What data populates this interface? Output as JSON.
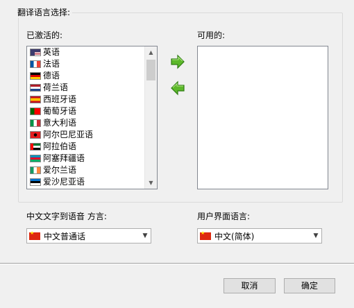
{
  "group_title": "翻译语言选择:",
  "active_label": "已激活的:",
  "available_label": "可用的:",
  "active_languages": [
    {
      "name": "英语",
      "flag": "us-flag-icon"
    },
    {
      "name": "法语",
      "flag": "france-flag-icon"
    },
    {
      "name": "德语",
      "flag": "germany-flag-icon"
    },
    {
      "name": "荷兰语",
      "flag": "netherlands-flag-icon"
    },
    {
      "name": "西班牙语",
      "flag": "spain-flag-icon"
    },
    {
      "name": "葡萄牙语",
      "flag": "portugal-flag-icon"
    },
    {
      "name": "意大利语",
      "flag": "italy-flag-icon"
    },
    {
      "name": "阿尔巴尼亚语",
      "flag": "albania-flag-icon"
    },
    {
      "name": "阿拉伯语",
      "flag": "uae-flag-icon"
    },
    {
      "name": "阿塞拜疆语",
      "flag": "azerbaijan-flag-icon"
    },
    {
      "name": "爱尔兰语",
      "flag": "ireland-flag-icon"
    },
    {
      "name": "爱沙尼亚语",
      "flag": "estonia-flag-icon"
    }
  ],
  "available_languages": [],
  "tts_label": "中文文字到语音 方言:",
  "tts_value": "中文普通话",
  "ui_lang_label": "用户界面语言:",
  "ui_lang_value": "中文(简体)",
  "cancel_label": "取消",
  "ok_label": "确定",
  "accent_green": "#5cb82a"
}
